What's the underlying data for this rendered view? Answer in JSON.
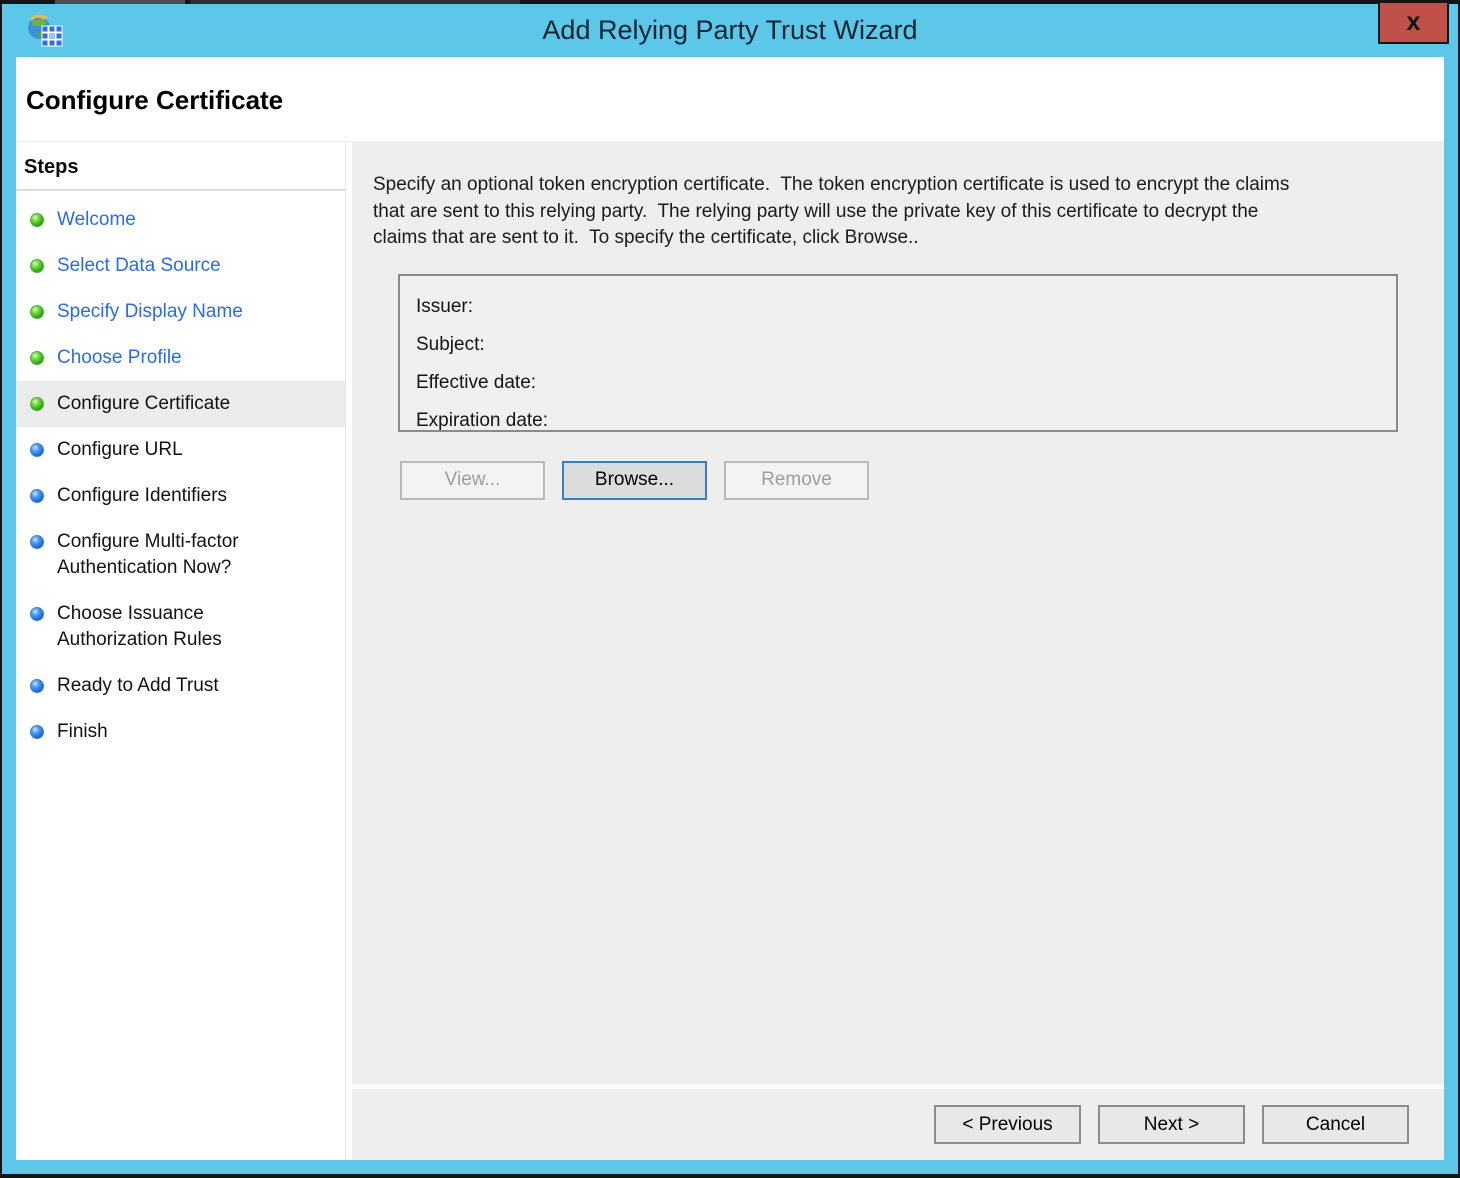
{
  "window": {
    "title": "Add Relying Party Trust Wizard",
    "close_glyph": "x"
  },
  "page": {
    "heading": "Configure Certificate"
  },
  "steps_panel": {
    "title": "Steps",
    "items": [
      {
        "label": "Welcome",
        "state": "completed"
      },
      {
        "label": "Select Data Source",
        "state": "completed"
      },
      {
        "label": "Specify Display Name",
        "state": "completed"
      },
      {
        "label": "Choose Profile",
        "state": "completed"
      },
      {
        "label": "Configure Certificate",
        "state": "current"
      },
      {
        "label": "Configure URL",
        "state": "upcoming"
      },
      {
        "label": "Configure Identifiers",
        "state": "upcoming"
      },
      {
        "label": "Configure Multi-factor Authentication Now?",
        "state": "upcoming"
      },
      {
        "label": "Choose Issuance Authorization Rules",
        "state": "upcoming"
      },
      {
        "label": "Ready to Add Trust",
        "state": "upcoming"
      },
      {
        "label": "Finish",
        "state": "upcoming"
      }
    ]
  },
  "content": {
    "description": "Specify an optional token encryption certificate.  The token encryption certificate is used to encrypt the claims that are sent to this relying party.  The relying party will use the private key of this certificate to decrypt the claims that are sent to it.  To specify the certificate, click Browse..",
    "certificate": {
      "fields": [
        {
          "label": "Issuer:",
          "value": ""
        },
        {
          "label": "Subject:",
          "value": ""
        },
        {
          "label": "Effective date:",
          "value": ""
        },
        {
          "label": "Expiration date:",
          "value": ""
        }
      ]
    },
    "buttons": [
      {
        "label": "View...",
        "enabled": false,
        "focused": false
      },
      {
        "label": "Browse...",
        "enabled": true,
        "focused": true
      },
      {
        "label": "Remove",
        "enabled": false,
        "focused": false
      }
    ]
  },
  "footer": {
    "buttons": [
      {
        "label": "< Previous"
      },
      {
        "label": "Next >"
      },
      {
        "label": "Cancel"
      }
    ]
  },
  "colors": {
    "titlebar_blue": "#5cc7e8",
    "close_button_red": "#c05149",
    "title_text": "#0d2334",
    "completed_link_blue": "#2a6ce0",
    "bullet_green": "#2ea012",
    "bullet_blue": "#1668d6",
    "current_step_highlight": "#ececec",
    "main_background": "#efeeee",
    "certificate_box_border": "#8a8a8a",
    "disabled_text": "#9d9d9d",
    "focused_button_border": "#3a7ebf"
  }
}
